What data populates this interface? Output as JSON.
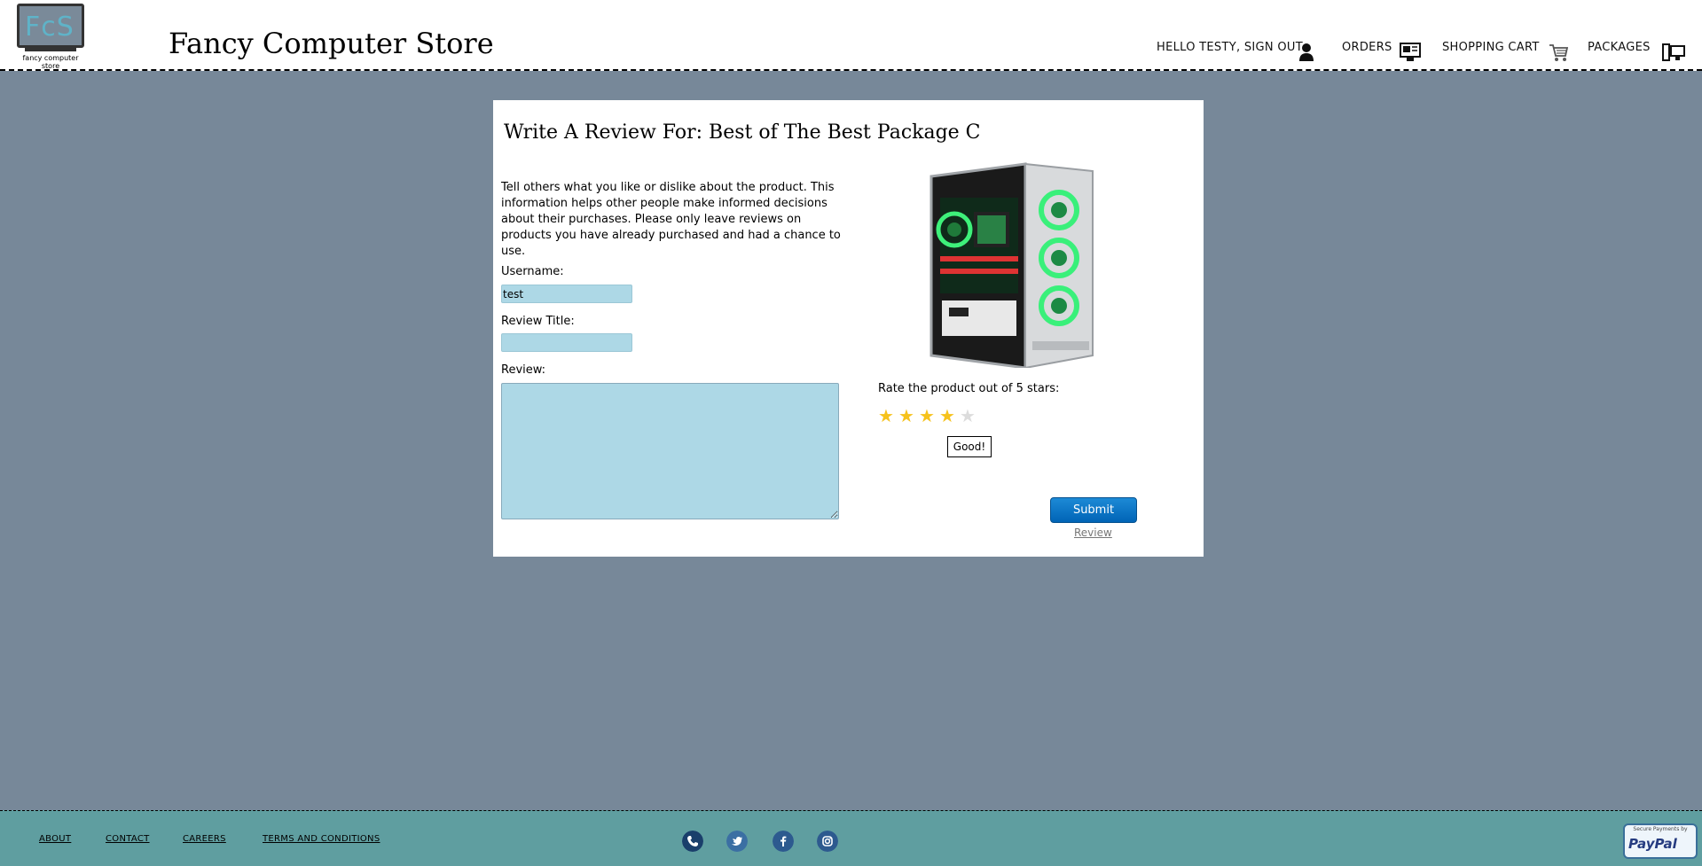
{
  "header": {
    "logo_letters": "FcS",
    "logo_caption": "fancy computer store",
    "site_title": "Fancy Computer Store",
    "nav": {
      "account": "HELLO TESTY, SIGN OUT",
      "orders": "ORDERS",
      "cart": "SHOPPING CART",
      "packages": "PACKAGES"
    }
  },
  "review": {
    "title": "Write A Review For: Best of The Best Package C",
    "intro": "Tell others what you like or dislike about the product. This information helps other people make informed decisions about their purchases. Please only leave reviews on products you have already purchased and had a chance to use.",
    "username_label": "Username:",
    "username_value": "test",
    "title_label": "Review Title:",
    "title_value": "",
    "review_label": "Review:",
    "review_value": "",
    "rate_label": "Rate the product out of 5 stars:",
    "rating": 4,
    "rating_max": 5,
    "rating_text": "Good!",
    "submit_label": "Submit",
    "submit_sub": "Review"
  },
  "footer": {
    "links": [
      "ABOUT",
      "CONTACT",
      "CAREERS",
      "TERMS AND CONDITIONS"
    ],
    "social": [
      "phone-icon",
      "twitter-icon",
      "facebook-icon",
      "instagram-icon"
    ],
    "paypal_top": "Secure Payments by",
    "paypal_logo": "PayPal"
  },
  "colors": {
    "page_bg": "#778899",
    "field_bg": "#add8e6",
    "footer_bg": "#5f9ea0",
    "star_on": "#f6c21c",
    "submit_bg": "#0a74c7"
  }
}
